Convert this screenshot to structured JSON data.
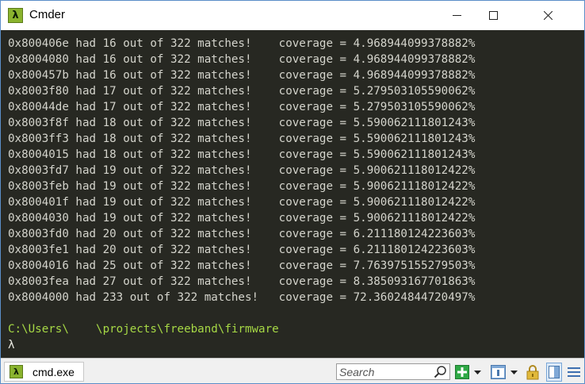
{
  "window": {
    "title": "Cmder",
    "controls": {
      "minimize": "minimize",
      "maximize": "maximize",
      "close": "close"
    }
  },
  "app_icon_glyph": "λ",
  "terminal": {
    "lines": [
      "0x800406e had 16 out of 322 matches!    coverage = 4.968944099378882%",
      "0x8004080 had 16 out of 322 matches!    coverage = 4.968944099378882%",
      "0x800457b had 16 out of 322 matches!    coverage = 4.968944099378882%",
      "0x8003f80 had 17 out of 322 matches!    coverage = 5.279503105590062%",
      "0x80044de had 17 out of 322 matches!    coverage = 5.279503105590062%",
      "0x8003f8f had 18 out of 322 matches!    coverage = 5.590062111801243%",
      "0x8003ff3 had 18 out of 322 matches!    coverage = 5.590062111801243%",
      "0x8004015 had 18 out of 322 matches!    coverage = 5.590062111801243%",
      "0x8003fd7 had 19 out of 322 matches!    coverage = 5.900621118012422%",
      "0x8003feb had 19 out of 322 matches!    coverage = 5.900621118012422%",
      "0x800401f had 19 out of 322 matches!    coverage = 5.900621118012422%",
      "0x8004030 had 19 out of 322 matches!    coverage = 5.900621118012422%",
      "0x8003fd0 had 20 out of 322 matches!    coverage = 6.211180124223603%",
      "0x8003fe1 had 20 out of 322 matches!    coverage = 6.211180124223603%",
      "0x8004016 had 25 out of 322 matches!    coverage = 7.763975155279503%",
      "0x8003fea had 27 out of 322 matches!    coverage = 8.385093167701863%",
      "0x8004000 had 233 out of 322 matches!   coverage = 72.36024844720497%"
    ],
    "blank_line": "",
    "path": "C:\\Users\\    \\projects\\freeband\\firmware",
    "prompt": "λ"
  },
  "statusbar": {
    "tab_label": "cmd.exe",
    "tab_icon_glyph": "λ",
    "search_placeholder": "Search"
  },
  "colors": {
    "terminal_bg": "#272822",
    "terminal_fg": "#d4d4cc",
    "path_color": "#a6d845",
    "icon_green": "#8ab32e"
  },
  "icons": {
    "app": "cmder-lambda-icon",
    "search": "search-icon",
    "add": "add-console-icon",
    "console": "console-icon",
    "lock": "lock-icon",
    "split": "split-view-icon",
    "menu": "menu-icon"
  }
}
